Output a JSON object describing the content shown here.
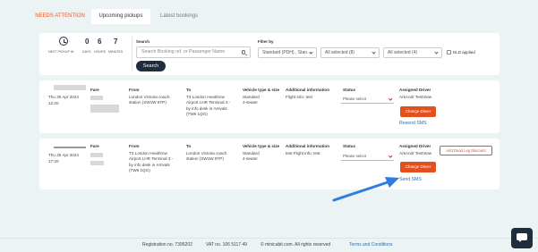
{
  "tabs": [
    {
      "label": "NEEDS ATTENTION",
      "active": false
    },
    {
      "label": "Upcoming pickups",
      "active": true
    },
    {
      "label": "Latest bookings",
      "active": false
    }
  ],
  "countdown": {
    "label": "NEXT PICKUP IN",
    "days": "0",
    "hours": "6",
    "minutes": "7",
    "days_label": "DAYS",
    "hours_label": "HOURS",
    "minutes_label": "MINUTES"
  },
  "search": {
    "label": "Search",
    "placeholder": "Search Booking ref. or Passenger Name",
    "button": "Search"
  },
  "filter": {
    "label": "Filter by",
    "vehicle": "Standard (PDH) , Stan...",
    "status": "All selected (8)",
    "other": "All selected (4)",
    "dld_label": "DLD applied"
  },
  "headers": {
    "fare": "Fare",
    "from": "From",
    "to": "To",
    "vehicle": "Vehicle type & size",
    "info": "Additional information",
    "status": "Status",
    "driver": "Assigned Driver"
  },
  "bookings": [
    {
      "date": "Thu 25 Apr 2024",
      "time": "12:20",
      "from": [
        "London Victoria coach",
        "station (SW1W 9TP)"
      ],
      "to": [
        "T3 London Heathrow",
        "Airport LHR Terminal 3 -",
        "by info desk in Arrivals",
        "(TW6 1QG)"
      ],
      "vehicle": [
        "Standard",
        "4-seater"
      ],
      "info": "Flight info: test",
      "status": "Please select",
      "driver": "ArkAndr TestView",
      "change_driver": "Change Driver",
      "sms": "Resend SMS"
    },
    {
      "date": "Thu 25 Apr 2024",
      "time": "17:20",
      "from": [
        "T3 London Heathrow",
        "Airport LHR Terminal 3 -",
        "by info desk in Arrivals",
        "(TW6 1QG)"
      ],
      "to": [
        "London Victoria coach",
        "station (SW1W 9TP)"
      ],
      "vehicle": [
        "Standard",
        "4-seater"
      ],
      "info": "test Flight info: test",
      "status": "Please select",
      "driver": "ArkAndr TestView",
      "change_driver": "Change Driver",
      "sms": "Send SMS",
      "dead_leg": "Add Dead Leg Discount"
    }
  ],
  "footer": {
    "registration": "Registration no. 7395202",
    "vat": "VAT no. 106 5117 49",
    "copyright": "© minicabit.com. All rights reserved",
    "terms": "Terms and Conditions"
  },
  "colors": {
    "accent": "#e2511d",
    "dark": "#1f2d3d",
    "link": "#2d6ea8",
    "background": "#ebf3f5",
    "arrow": "#2f7de0"
  },
  "icons": [
    "clock-icon",
    "search-icon",
    "chevron-down-icon",
    "chat-icon"
  ]
}
